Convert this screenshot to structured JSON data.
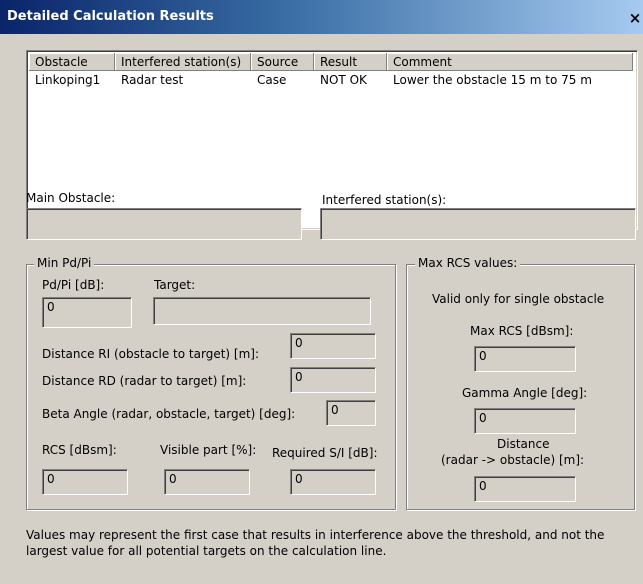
{
  "window": {
    "title": "Detailed Calculation Results",
    "close_label": "×"
  },
  "list": {
    "columns": [
      "Obstacle",
      "Interfered station(s)",
      "Source",
      "Result",
      "Comment"
    ],
    "rows": [
      [
        "Linkoping1",
        "Radar test",
        "Case",
        "NOT OK",
        "Lower the obstacle 15 m to 75 m"
      ]
    ]
  },
  "main_obstacle": {
    "label": "Main Obstacle:",
    "value": ""
  },
  "interfered_stations": {
    "label": "Interfered station(s):",
    "value": ""
  },
  "min_pd_pi": {
    "title": "Min Pd/Pi",
    "pd_pi_label": "Pd/Pi [dB]:",
    "pd_pi_value": "0",
    "target_label": "Target:",
    "target_value": "",
    "distance_ri_label": "Distance RI (obstacle to target) [m]:",
    "distance_ri_value": "0",
    "distance_rd_label": "Distance RD (radar to target) [m]:",
    "distance_rd_value": "0",
    "beta_label": "Beta Angle (radar, obstacle, target) [deg]:",
    "beta_value": "0",
    "rcs_label": "RCS [dBsm]:",
    "rcs_value": "0",
    "visible_label": "Visible part [%]:",
    "visible_value": "0",
    "required_si_label": "Required S/I [dB]:",
    "required_si_value": "0"
  },
  "max_rcs": {
    "title": "Max RCS values:",
    "note": "Valid only for single obstacle",
    "max_rcs_label": "Max RCS [dBsm]:",
    "max_rcs_value": "0",
    "gamma_label": "Gamma Angle [deg]:",
    "gamma_value": "0",
    "distance_label_1": "Distance",
    "distance_label_2": "(radar -> obstacle) [m]:",
    "distance_value": "0"
  },
  "footnote": {
    "line1": "Values may represent the first case that results in interference above the threshold, and not the",
    "line2": "largest value for all potential targets on the calculation line."
  }
}
